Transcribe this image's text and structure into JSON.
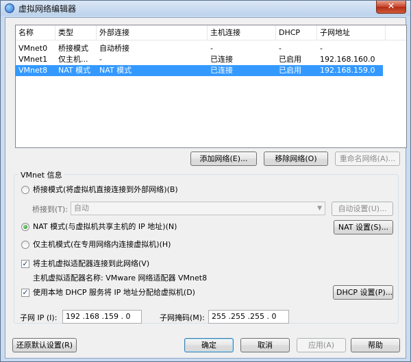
{
  "window": {
    "title": "虚拟网络编辑器",
    "close_glyph": "✕"
  },
  "table": {
    "columns": [
      "名称",
      "类型",
      "外部连接",
      "主机连接",
      "DHCP",
      "子网地址"
    ],
    "rows": [
      {
        "name": "VMnet0",
        "type": "桥接模式",
        "external": "自动桥接",
        "host": "-",
        "dhcp": "-",
        "subnet": "-",
        "selected": false
      },
      {
        "name": "VMnet1",
        "type": "仅主机...",
        "external": "-",
        "host": "已连接",
        "dhcp": "已启用",
        "subnet": "192.168.160.0",
        "selected": false
      },
      {
        "name": "VMnet8",
        "type": "NAT 模式",
        "external": "NAT 模式",
        "host": "已连接",
        "dhcp": "已启用",
        "subnet": "192.168.159.0",
        "selected": true
      }
    ]
  },
  "table_buttons": {
    "add": "添加网络(E)...",
    "remove": "移除网络(O)",
    "rename": "重命名网络(A)..."
  },
  "vmnet_info": {
    "group_title": "VMnet 信息",
    "bridged_label": "桥接模式(将虚拟机直接连接到外部网络)(B)",
    "bridged_to_label": "桥接到(T):",
    "bridged_to_value": "自动",
    "auto_settings": "自动设置(U)...",
    "nat_label": "NAT 模式(与虚拟机共享主机的 IP 地址)(N)",
    "nat_settings": "NAT 设置(S)...",
    "hostonly_label": "仅主机模式(在专用网络内连接虚拟机)(H)",
    "connect_adapter_label": "将主机虚拟适配器连接到此网络(V)",
    "adapter_name_label": "主机虚拟适配器名称: VMware 网络适配器 VMnet8",
    "dhcp_label": "使用本地 DHCP 服务将 IP 地址分配给虚拟机(D)",
    "dhcp_settings": "DHCP 设置(P)...",
    "check_glyph": "✓",
    "selected_mode": "nat"
  },
  "subnet": {
    "ip_label": "子网 IP (I):",
    "ip_value": "192 .168 .159 . 0",
    "mask_label": "子网掩码(M):",
    "mask_value": "255 .255 .255 . 0"
  },
  "footer": {
    "restore": "还原默认设置(R)",
    "ok": "确定",
    "cancel": "取消",
    "apply": "应用(A)",
    "help": "帮助"
  },
  "icons": {
    "combo_arrow": "▼"
  }
}
